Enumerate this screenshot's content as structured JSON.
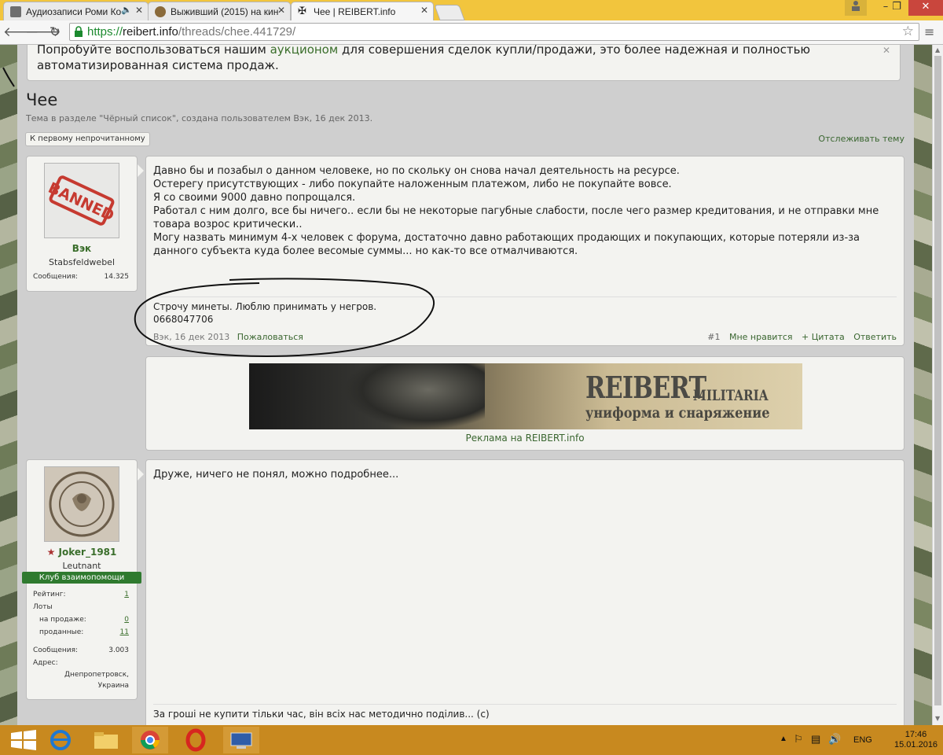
{
  "browser": {
    "tabs": [
      {
        "title": "Аудиозаписи Роми Ко",
        "active": false
      },
      {
        "title": "Выживший (2015) на кин",
        "active": false
      },
      {
        "title": "Чее | REIBERT.info",
        "active": true
      }
    ],
    "address": {
      "scheme": "https://",
      "host": "reibert.info",
      "path": "/threads/chee.441729/"
    },
    "window_controls": {
      "minimize": "–",
      "maximize": "❐",
      "close": "✕"
    }
  },
  "notice": {
    "text_before": "Попробуйте воспользоваться нашим ",
    "link": "аукционом",
    "text_after": " для совершения сделок купли/продажи, это более надежная и полностью автоматизированная система продаж."
  },
  "thread": {
    "title": "Чее",
    "meta": "Тема в разделе \"Чёрный список\", создана пользователем Вэк, 16 дек 2013.",
    "first_unread": "К первому непрочитанному",
    "watch": "Отслеживать тему"
  },
  "posts": [
    {
      "user": {
        "name": "Вэк",
        "title": "Stabsfeldwebel",
        "avatar": "banned-stamp",
        "stats": [
          {
            "label": "Сообщения:",
            "value": "14.325"
          }
        ]
      },
      "lines": [
        "Давно бы и позабыл о данном человеке, но по скольку он снова начал деятельность на ресурсе.",
        "Остерегу присутствующих - либо покупайте наложенным платежом, либо не покупайте вовсе.",
        "Я со своими 9000 давно попрощался.",
        "Работал с ним долго, все бы ничего.. если бы не некоторые пагубные слабости, после чего размер кредитования, и не отправки мне товара возрос критически..",
        "Могу назвать минимум 4-х человек с форума, достаточно давно работающих продающих и покупающих, которые потеряли из-за данного субъекта куда более весомые суммы... но как-то все отмалчиваются."
      ],
      "signature": [
        "Строчу минеты. Люблю принимать у негров.",
        "0668047706"
      ],
      "footer": {
        "author_date": "Вэк, 16 дек 2013",
        "report": "Пожаловаться",
        "number": "#1",
        "like": "Мне нравится",
        "quote": "+ Цитата",
        "reply": "Ответить"
      }
    },
    {
      "user": {
        "name": "Joker_1981",
        "title": "Leutnant",
        "badge": "Клуб взаимопомощи",
        "avatar": "reibert-seal",
        "rating_label": "Рейтинг:",
        "rating": "1",
        "lots_label": "Лоты",
        "for_sale_label": "на продаже:",
        "for_sale": "0",
        "sold_label": "проданные:",
        "sold": "11",
        "messages_label": "Сообщения:",
        "messages": "3.003",
        "address_label": "Адрес:",
        "address": "Днепропетровск, Украина"
      },
      "lines": [
        "Друже, ничего не понял, можно подробнее..."
      ],
      "signature": [
        "За гроші не купити тільки час, він всіх нас методично поділив... (с)"
      ]
    }
  ],
  "ad": {
    "brand": "REIBERT",
    "brand2": "MILITARIA",
    "subtitle": "униформа и снаряжение",
    "caption": "Реклама на REIBERT.info"
  },
  "taskbar": {
    "lang": "ENG",
    "time": "17:46",
    "date": "15.01.2016"
  }
}
